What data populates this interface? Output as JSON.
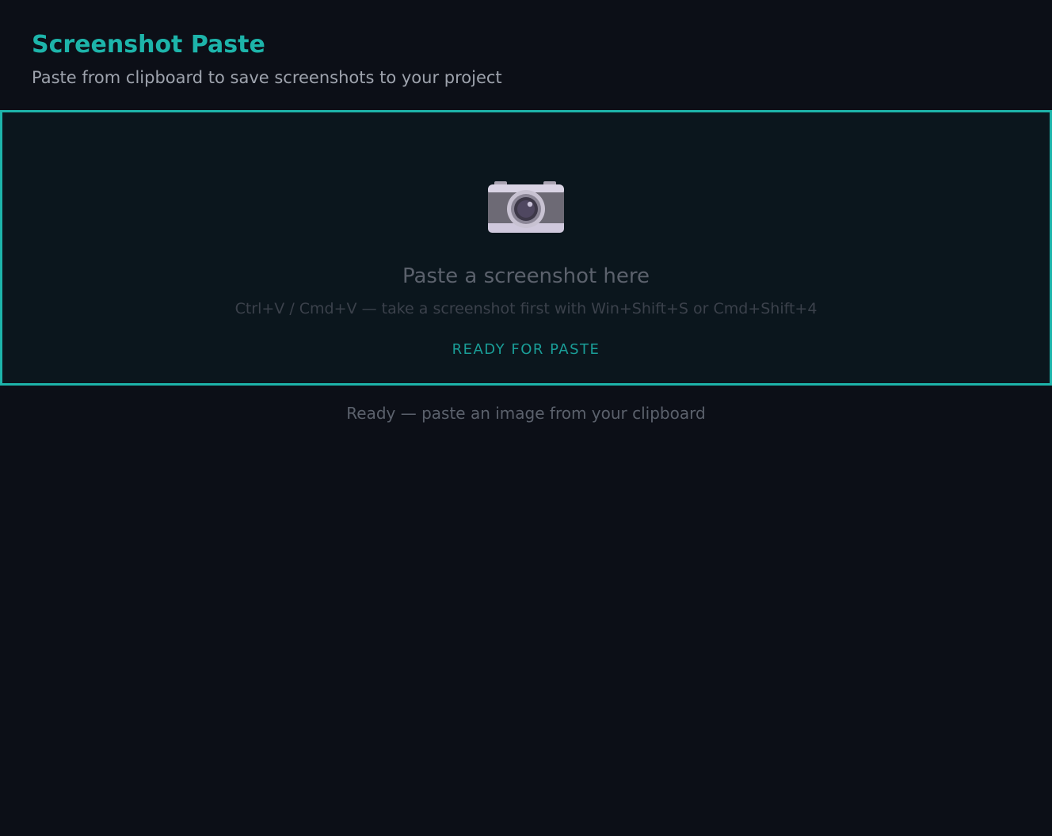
{
  "header": {
    "title": "Screenshot Paste",
    "subtitle": "Paste from clipboard to save screenshots to your project"
  },
  "dropzone": {
    "icon": "camera-icon",
    "title": "Paste a screenshot here",
    "hint": "Ctrl+V / Cmd+V — take a screenshot first with Win+Shift+S or Cmd+Shift+4",
    "badge": "READY FOR PASTE"
  },
  "status": {
    "text": "Ready — paste an image from your clipboard"
  },
  "colors": {
    "accent": "#1db4aa",
    "background": "#0c0f17",
    "dropzone_background": "#0b161d"
  }
}
